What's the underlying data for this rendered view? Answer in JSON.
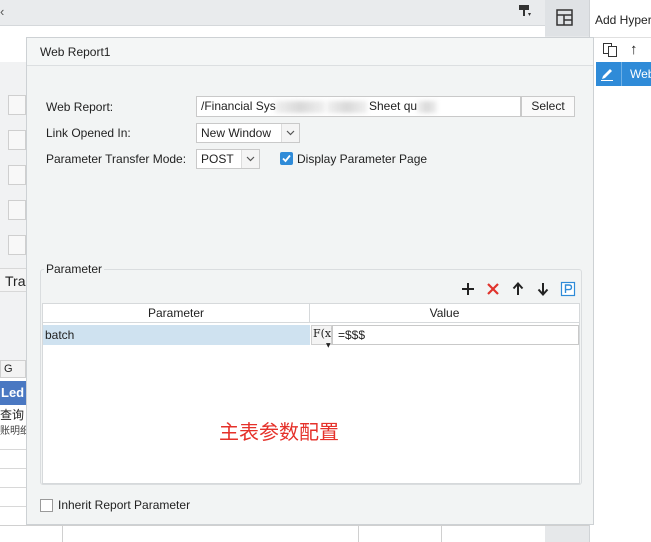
{
  "background": {
    "left_glyph": "‹",
    "row_header": "G",
    "ledger_text": "Led",
    "tra_text": "Tra",
    "cn_text_1": "查询",
    "cn_text_2": "账明细",
    "right_panel_title": "Add Hyper",
    "right_selected_item": "Web"
  },
  "dialog": {
    "title": "Web Report1",
    "web_report_label": "Web Report:",
    "web_report_value": "/Financial Sys",
    "web_report_value_tail": "Sheet qu",
    "select_label": "Select",
    "link_opened_label": "Link Opened In:",
    "link_opened_value": "New Window",
    "transfer_mode_label": "Parameter Transfer Mode:",
    "transfer_mode_value": "POST",
    "display_param_label": "Display Parameter Page",
    "display_param_checked": true,
    "parameter_group_label": "Parameter",
    "table": {
      "headers": [
        "Parameter",
        "Value"
      ],
      "rows": [
        {
          "name": "batch",
          "formula_button": "F(x)",
          "value": "=$$$"
        }
      ]
    },
    "annotation": "主表参数配置",
    "inherit_label": "Inherit Report Parameter",
    "inherit_checked": false
  },
  "colors": {
    "accent": "#2f8bd8",
    "annotation_red": "#e5312a",
    "selected_row": "#cfe2f0",
    "ledger_blue": "#4a78c2"
  },
  "icons": [
    "add-icon",
    "delete-icon",
    "move-up-icon",
    "move-down-icon",
    "param-p-icon",
    "copy-icon",
    "edit-pencil-icon",
    "format-painter-icon",
    "grid-layout-icon"
  ]
}
